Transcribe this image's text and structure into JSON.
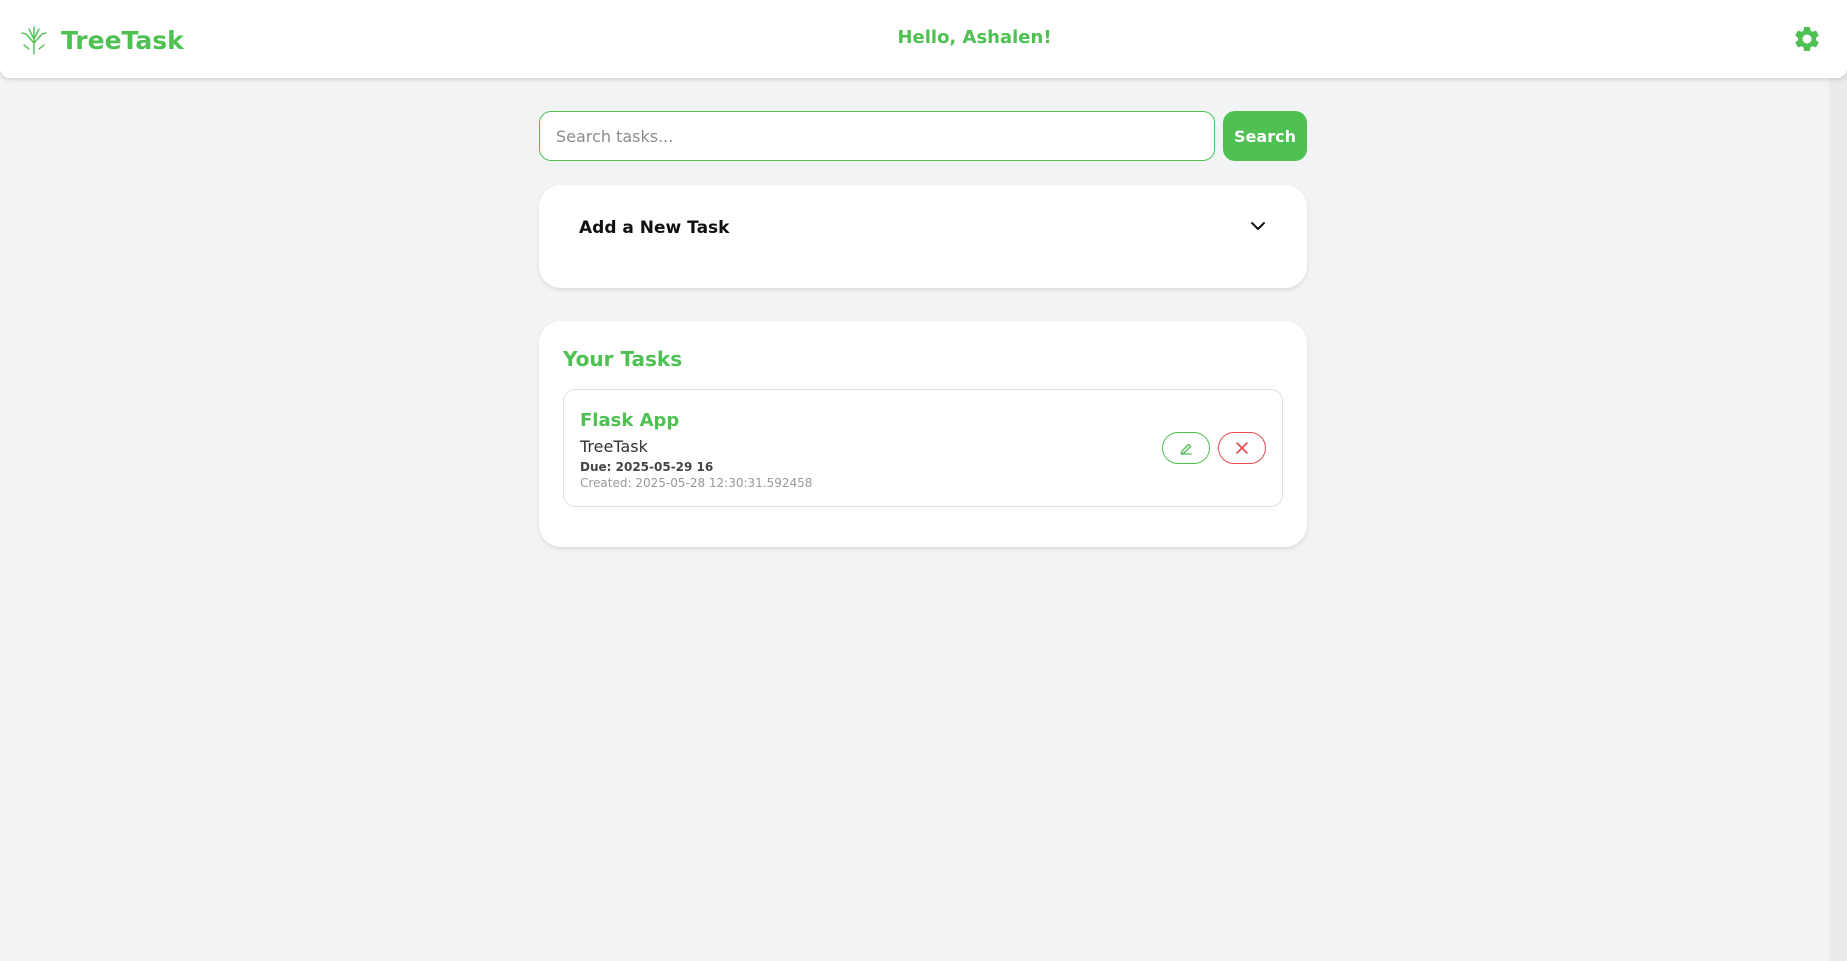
{
  "header": {
    "app_name": "TreeTask",
    "greeting": "Hello, Ashalen!"
  },
  "search": {
    "placeholder": "Search tasks...",
    "value": "",
    "button_label": "Search"
  },
  "add_task": {
    "title": "Add a New Task",
    "expanded": false
  },
  "tasks": {
    "title": "Your Tasks",
    "items": [
      {
        "title": "Flask App",
        "description": "TreeTask",
        "due": "Due: 2025-05-29 16",
        "created": "Created: 2025-05-28 12:30:31.592458"
      }
    ]
  },
  "colors": {
    "brand_green": "#4ec152",
    "danger_red": "#e5484d",
    "page_background": "#f1f3f5"
  },
  "icons": {
    "logo": "tree-logo-icon",
    "settings": "gear-icon",
    "collapse": "chevron-down-icon",
    "edit": "pencil-icon",
    "delete": "close-icon"
  }
}
